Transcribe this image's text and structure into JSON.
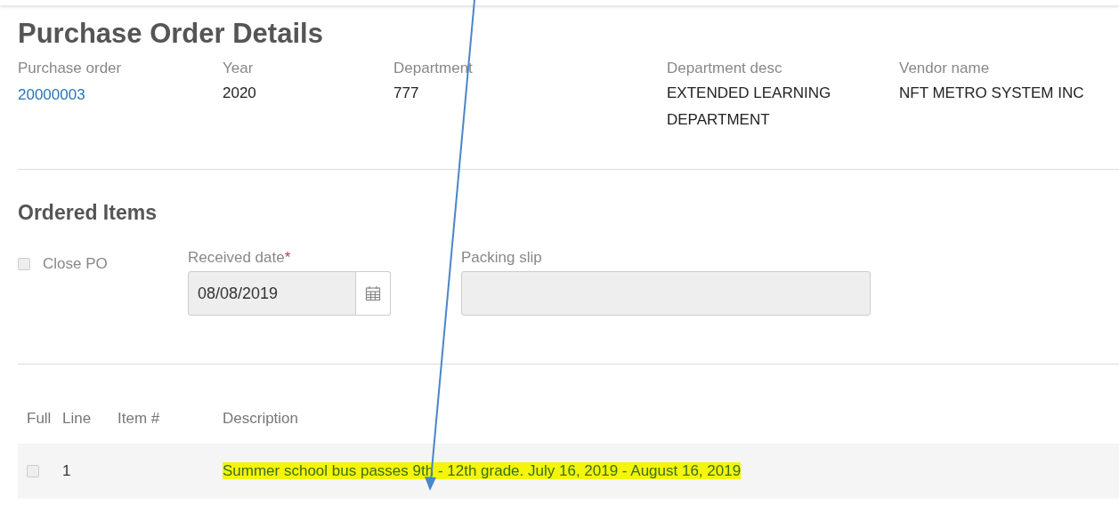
{
  "title": "Purchase Order Details",
  "header_fields": [
    {
      "label": "Purchase order",
      "value": "20000003",
      "kind": "link"
    },
    {
      "label": "Year",
      "value": "2020",
      "kind": "text"
    },
    {
      "label": "Department",
      "value": "777",
      "kind": "text"
    },
    {
      "label": "Department desc",
      "value": "EXTENDED LEARNING DEPARTMENT",
      "kind": "text"
    },
    {
      "label": "Vendor name",
      "value": "NFT METRO SYSTEM INC",
      "kind": "text"
    }
  ],
  "ordered_items": {
    "title": "Ordered Items",
    "close_po": {
      "label": "Close PO",
      "checked": false
    },
    "received_date": {
      "label": "Received date",
      "required_mark": "*",
      "value": "08/08/2019"
    },
    "packing_slip": {
      "label": "Packing slip"
    }
  },
  "table": {
    "columns": [
      "Full",
      "Line",
      "Item #",
      "Description"
    ],
    "rows": [
      {
        "full": false,
        "line": "1",
        "description": "Summer school bus passes 9th - 12th grade. July 16, 2019 - August 16, 2019",
        "highlighted": true
      }
    ]
  }
}
